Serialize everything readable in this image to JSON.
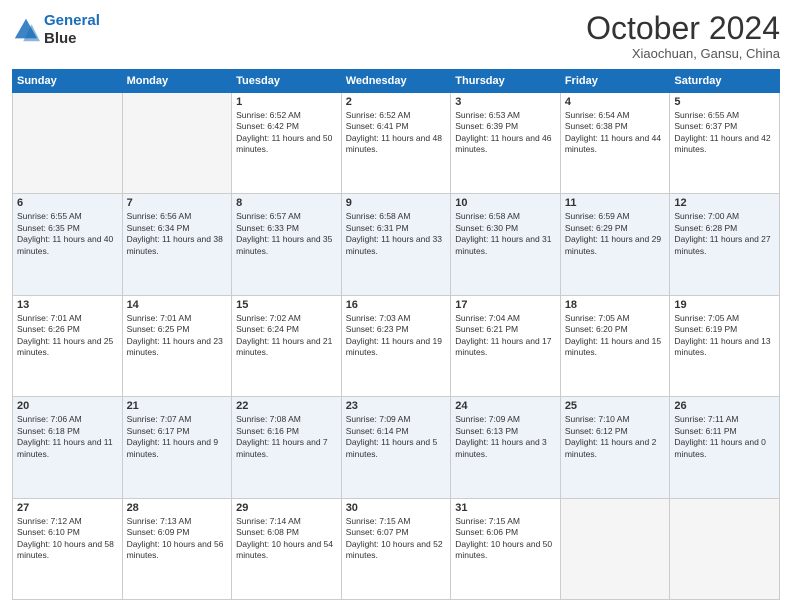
{
  "header": {
    "logo_line1": "General",
    "logo_line2": "Blue",
    "month": "October 2024",
    "location": "Xiaochuan, Gansu, China"
  },
  "weekdays": [
    "Sunday",
    "Monday",
    "Tuesday",
    "Wednesday",
    "Thursday",
    "Friday",
    "Saturday"
  ],
  "weeks": [
    [
      {
        "day": "",
        "empty": true
      },
      {
        "day": "",
        "empty": true
      },
      {
        "day": "1",
        "sunrise": "6:52 AM",
        "sunset": "6:42 PM",
        "daylight": "11 hours and 50 minutes."
      },
      {
        "day": "2",
        "sunrise": "6:52 AM",
        "sunset": "6:41 PM",
        "daylight": "11 hours and 48 minutes."
      },
      {
        "day": "3",
        "sunrise": "6:53 AM",
        "sunset": "6:39 PM",
        "daylight": "11 hours and 46 minutes."
      },
      {
        "day": "4",
        "sunrise": "6:54 AM",
        "sunset": "6:38 PM",
        "daylight": "11 hours and 44 minutes."
      },
      {
        "day": "5",
        "sunrise": "6:55 AM",
        "sunset": "6:37 PM",
        "daylight": "11 hours and 42 minutes."
      }
    ],
    [
      {
        "day": "6",
        "sunrise": "6:55 AM",
        "sunset": "6:35 PM",
        "daylight": "11 hours and 40 minutes."
      },
      {
        "day": "7",
        "sunrise": "6:56 AM",
        "sunset": "6:34 PM",
        "daylight": "11 hours and 38 minutes."
      },
      {
        "day": "8",
        "sunrise": "6:57 AM",
        "sunset": "6:33 PM",
        "daylight": "11 hours and 35 minutes."
      },
      {
        "day": "9",
        "sunrise": "6:58 AM",
        "sunset": "6:31 PM",
        "daylight": "11 hours and 33 minutes."
      },
      {
        "day": "10",
        "sunrise": "6:58 AM",
        "sunset": "6:30 PM",
        "daylight": "11 hours and 31 minutes."
      },
      {
        "day": "11",
        "sunrise": "6:59 AM",
        "sunset": "6:29 PM",
        "daylight": "11 hours and 29 minutes."
      },
      {
        "day": "12",
        "sunrise": "7:00 AM",
        "sunset": "6:28 PM",
        "daylight": "11 hours and 27 minutes."
      }
    ],
    [
      {
        "day": "13",
        "sunrise": "7:01 AM",
        "sunset": "6:26 PM",
        "daylight": "11 hours and 25 minutes."
      },
      {
        "day": "14",
        "sunrise": "7:01 AM",
        "sunset": "6:25 PM",
        "daylight": "11 hours and 23 minutes."
      },
      {
        "day": "15",
        "sunrise": "7:02 AM",
        "sunset": "6:24 PM",
        "daylight": "11 hours and 21 minutes."
      },
      {
        "day": "16",
        "sunrise": "7:03 AM",
        "sunset": "6:23 PM",
        "daylight": "11 hours and 19 minutes."
      },
      {
        "day": "17",
        "sunrise": "7:04 AM",
        "sunset": "6:21 PM",
        "daylight": "11 hours and 17 minutes."
      },
      {
        "day": "18",
        "sunrise": "7:05 AM",
        "sunset": "6:20 PM",
        "daylight": "11 hours and 15 minutes."
      },
      {
        "day": "19",
        "sunrise": "7:05 AM",
        "sunset": "6:19 PM",
        "daylight": "11 hours and 13 minutes."
      }
    ],
    [
      {
        "day": "20",
        "sunrise": "7:06 AM",
        "sunset": "6:18 PM",
        "daylight": "11 hours and 11 minutes."
      },
      {
        "day": "21",
        "sunrise": "7:07 AM",
        "sunset": "6:17 PM",
        "daylight": "11 hours and 9 minutes."
      },
      {
        "day": "22",
        "sunrise": "7:08 AM",
        "sunset": "6:16 PM",
        "daylight": "11 hours and 7 minutes."
      },
      {
        "day": "23",
        "sunrise": "7:09 AM",
        "sunset": "6:14 PM",
        "daylight": "11 hours and 5 minutes."
      },
      {
        "day": "24",
        "sunrise": "7:09 AM",
        "sunset": "6:13 PM",
        "daylight": "11 hours and 3 minutes."
      },
      {
        "day": "25",
        "sunrise": "7:10 AM",
        "sunset": "6:12 PM",
        "daylight": "11 hours and 2 minutes."
      },
      {
        "day": "26",
        "sunrise": "7:11 AM",
        "sunset": "6:11 PM",
        "daylight": "11 hours and 0 minutes."
      }
    ],
    [
      {
        "day": "27",
        "sunrise": "7:12 AM",
        "sunset": "6:10 PM",
        "daylight": "10 hours and 58 minutes."
      },
      {
        "day": "28",
        "sunrise": "7:13 AM",
        "sunset": "6:09 PM",
        "daylight": "10 hours and 56 minutes."
      },
      {
        "day": "29",
        "sunrise": "7:14 AM",
        "sunset": "6:08 PM",
        "daylight": "10 hours and 54 minutes."
      },
      {
        "day": "30",
        "sunrise": "7:15 AM",
        "sunset": "6:07 PM",
        "daylight": "10 hours and 52 minutes."
      },
      {
        "day": "31",
        "sunrise": "7:15 AM",
        "sunset": "6:06 PM",
        "daylight": "10 hours and 50 minutes."
      },
      {
        "day": "",
        "empty": true
      },
      {
        "day": "",
        "empty": true
      }
    ]
  ]
}
